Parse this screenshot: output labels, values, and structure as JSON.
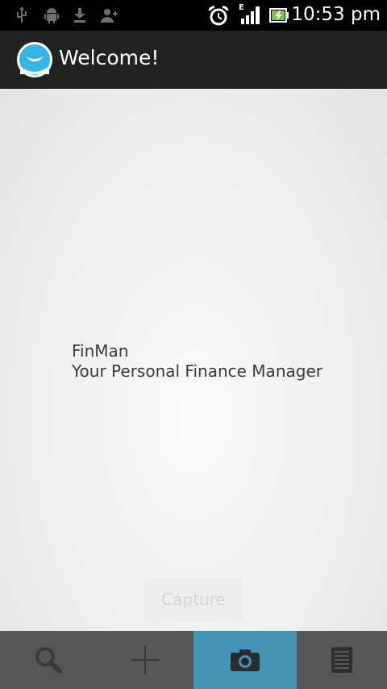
{
  "status_bar": {
    "time": "10:53 pm",
    "icons": [
      "usb-icon",
      "android-debug-icon",
      "download-icon",
      "add-contact-icon",
      "alarm-icon",
      "signal-e-icon",
      "battery-charging-icon"
    ],
    "network_type": "E"
  },
  "action_bar": {
    "title": "Welcome!",
    "app_icon": "finman-logo-icon",
    "accent_color": "#33b5e5"
  },
  "content": {
    "app_name": "FinMan",
    "subtitle": "Your Personal Finance Manager",
    "capture_button": "Capture"
  },
  "tabs": [
    {
      "icon": "search-icon",
      "active": false
    },
    {
      "icon": "add-icon",
      "active": false
    },
    {
      "icon": "camera-icon",
      "active": true
    },
    {
      "icon": "document-icon",
      "active": false
    }
  ],
  "colors": {
    "active_tab": "#4593b5",
    "tab_bar": "#565656",
    "action_bar": "#222222"
  }
}
